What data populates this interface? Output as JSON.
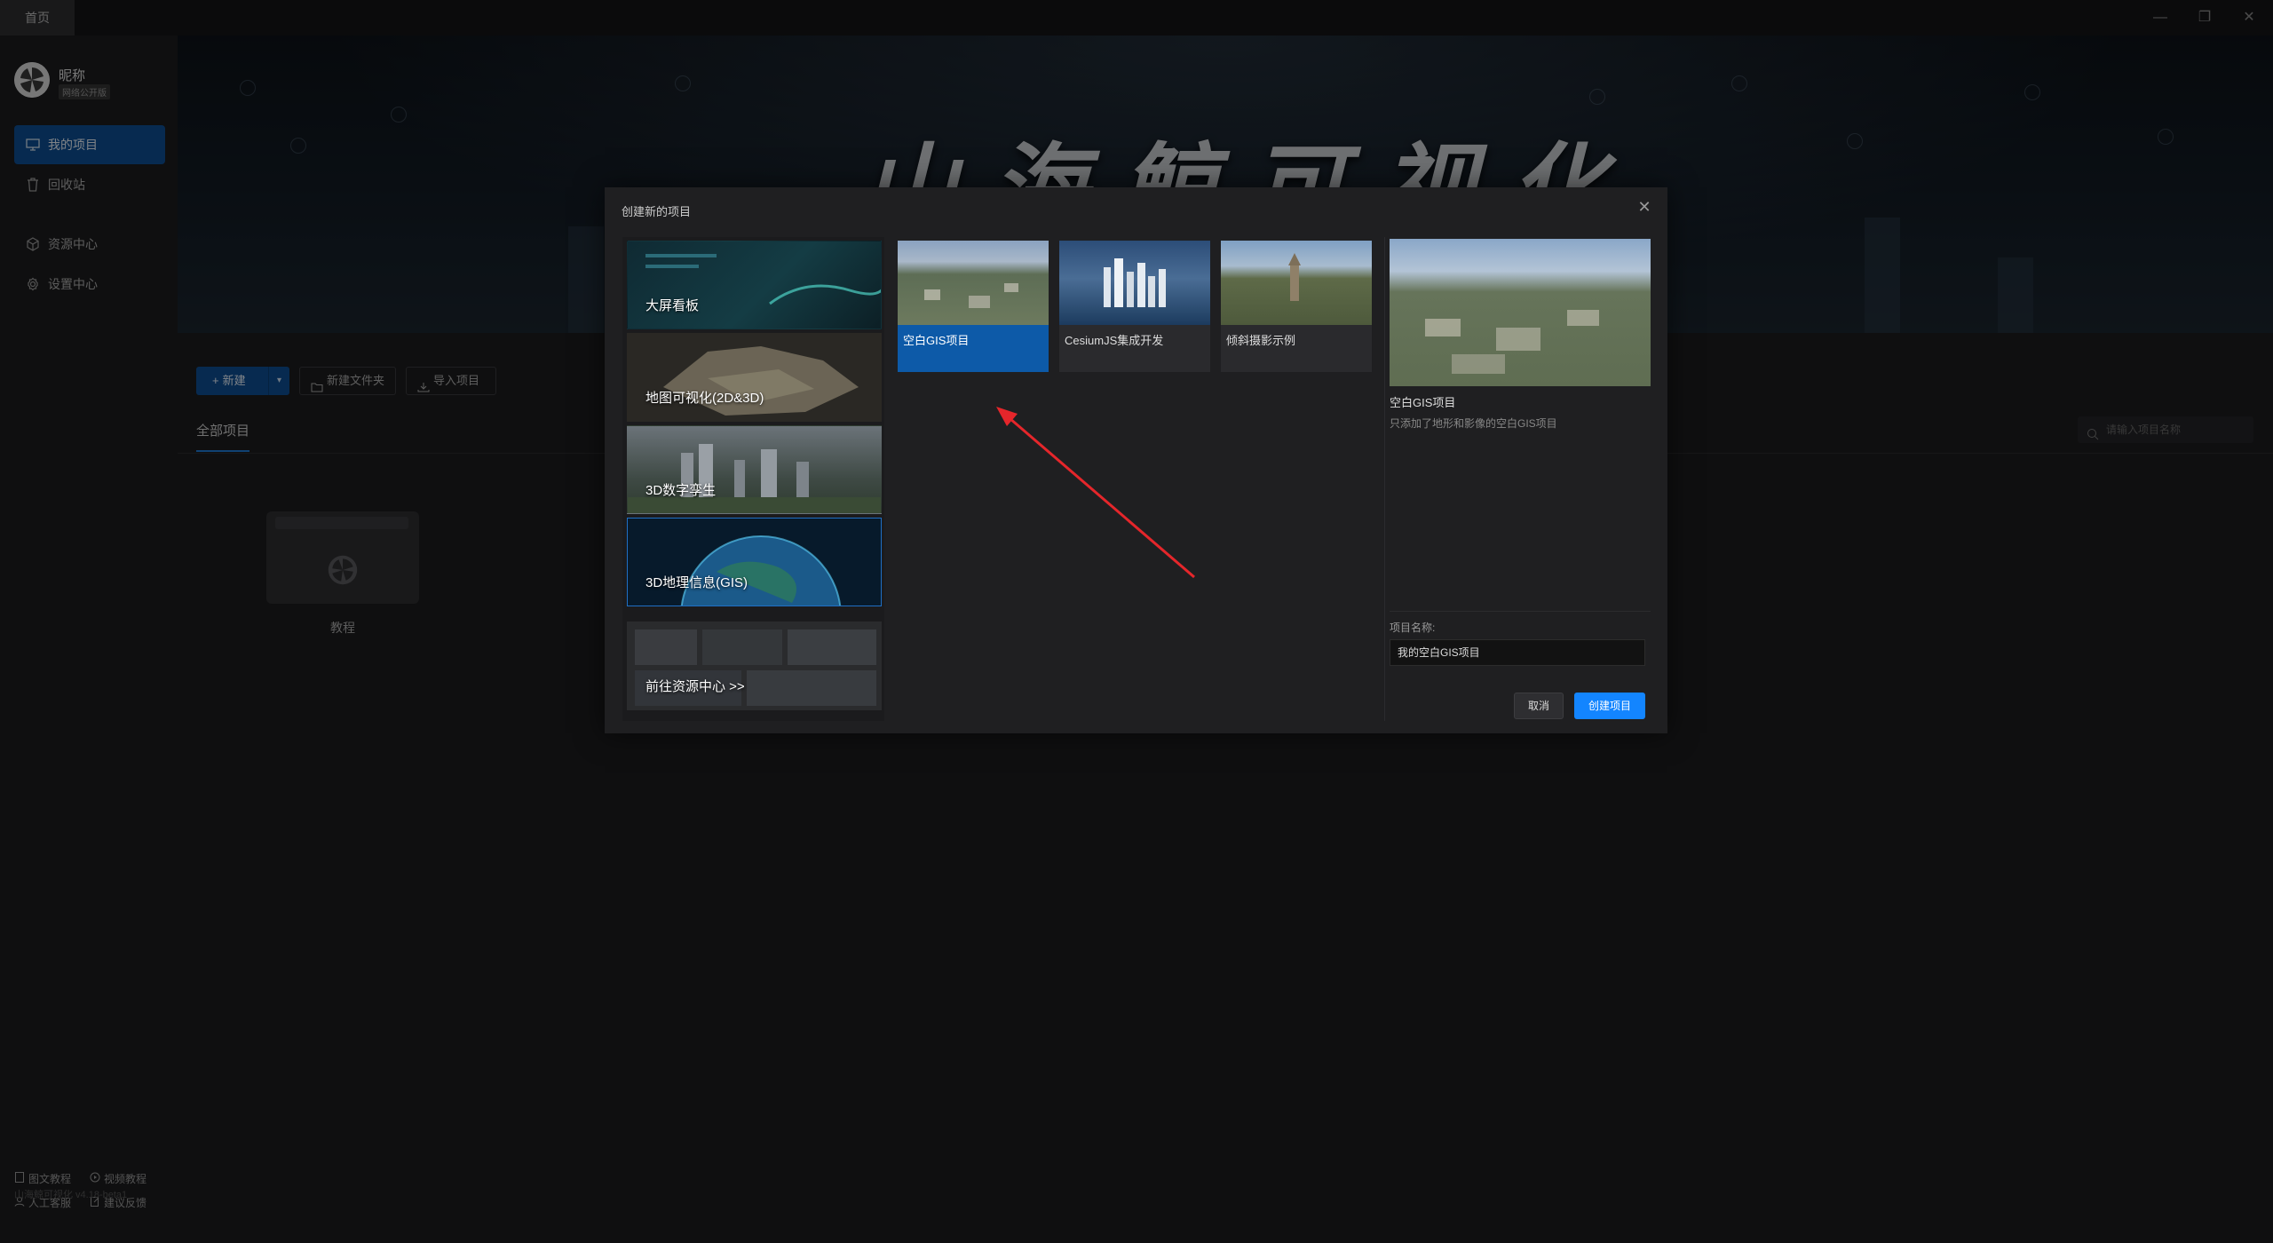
{
  "titlebar": {
    "home_tab": "首页",
    "minimize": "—",
    "restore": "❐",
    "close": "✕"
  },
  "sidebar": {
    "nickname": "昵称",
    "edition": "网络公开版",
    "items": [
      {
        "label": "我的项目",
        "icon": "projects-icon",
        "active": true
      },
      {
        "label": "回收站",
        "icon": "trash-icon"
      },
      {
        "label": "资源中心",
        "icon": "box-icon"
      },
      {
        "label": "设置中心",
        "icon": "gear-icon"
      }
    ],
    "footer": {
      "doc_tutorial": "图文教程",
      "video_tutorial": "视频教程",
      "support": "人工客服",
      "feedback": "建议反馈"
    },
    "version": "山海鲸可视化 v4.18-beta1"
  },
  "banner": {
    "title": "山海鲸可视化"
  },
  "toolbar": {
    "new_label": "新建",
    "new_folder_label": "新建文件夹",
    "import_label": "导入项目"
  },
  "projects": {
    "tab_all": "全部项目",
    "search_placeholder": "请输入项目名称",
    "items": [
      {
        "label": "教程"
      }
    ]
  },
  "modal": {
    "title": "创建新的项目",
    "categories": [
      {
        "label": "大屏看板"
      },
      {
        "label": "地图可视化(2D&3D)"
      },
      {
        "label": "3D数字孪生"
      },
      {
        "label": "3D地理信息(GIS)",
        "active": true
      },
      {
        "label": "前往资源中心 >>"
      }
    ],
    "templates": [
      {
        "label": "空白GIS项目",
        "active": true
      },
      {
        "label": "CesiumJS集成开发"
      },
      {
        "label": "倾斜摄影示例"
      }
    ],
    "preview": {
      "name": "空白GIS项目",
      "desc": "只添加了地形和影像的空白GIS项目"
    },
    "project_name_label": "项目名称:",
    "project_name_value": "我的空白GIS项目",
    "cancel_label": "取消",
    "create_label": "创建项目"
  },
  "colors": {
    "accent": "#1385ff",
    "nav_active": "#0e4e93",
    "annotation_arrow": "#e5262b"
  }
}
